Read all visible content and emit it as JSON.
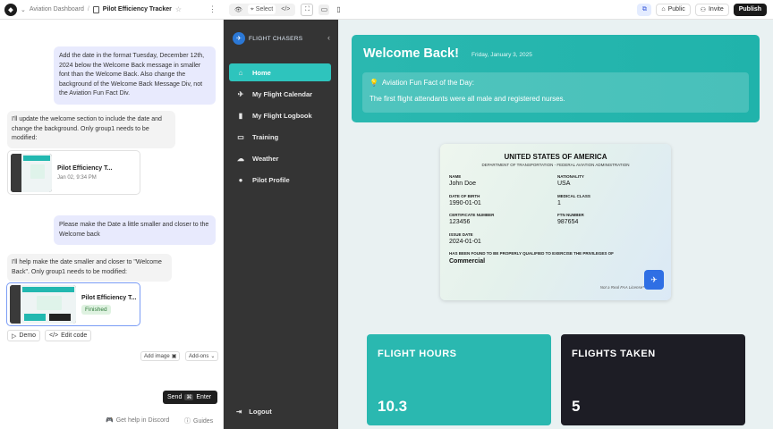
{
  "topbar": {
    "breadcrumb_root": "Aviation Dashboard",
    "project_title": "Pilot Efficiency Tracker",
    "select_label": "Select",
    "public_label": "Public",
    "invite_label": "Invite",
    "publish_label": "Publish"
  },
  "chat": {
    "msg1": "Add the date in the format Tuesday, December 12th, 2024 below the Welcome Back message in smaller font than the Welcome Back. Also change the background of the Welcome Back Message Div, not the Aviation Fun Fact Div.",
    "reply1": "I'll update the welcome section to include the date and change the background. Only group1 needs to be modified:",
    "card1": {
      "title": "Pilot Efficiency T...",
      "sub": "Jan 02, 9:34 PM"
    },
    "msg2": "Please make the Date a little smaller and closer to the Welcome back",
    "reply2": "I'll help make the date smaller and closer to \"Welcome Back\". Only group1 needs to be modified:",
    "card2": {
      "title": "Pilot Efficiency T...",
      "badge": "Finished"
    },
    "demo_label": "Demo",
    "edit_code_label": "Edit code",
    "add_image_label": "Add image",
    "addons_label": "Add-ons",
    "send_label": "Send",
    "send_key1": "⌘",
    "send_key2": "Enter",
    "discord_label": "Get help in Discord",
    "guides_label": "Guides"
  },
  "app": {
    "brand": "FLIGHT CHASERS",
    "nav": [
      {
        "label": "Home",
        "icon": "home-icon"
      },
      {
        "label": "My Flight Calendar",
        "icon": "plane-icon"
      },
      {
        "label": "My Flight Logbook",
        "icon": "book-icon"
      },
      {
        "label": "Training",
        "icon": "laptop-icon"
      },
      {
        "label": "Weather",
        "icon": "cloud-icon"
      },
      {
        "label": "Pilot Profile",
        "icon": "user-icon"
      }
    ],
    "logout_label": "Logout",
    "welcome_title": "Welcome Back!",
    "welcome_date": "Friday, January 3, 2025",
    "fact_heading": "Aviation Fun Fact of the Day:",
    "fact_text": "The first flight attendants were all male and registered nurses.",
    "license": {
      "country": "UNITED STATES OF AMERICA",
      "agency": "DEPARTMENT OF TRANSPORTATION - FEDERAL AVIATION ADMINISTRATION",
      "name_label": "NAME",
      "name": "John Doe",
      "nationality_label": "NATIONALITY",
      "nationality": "USA",
      "dob_label": "DATE OF BIRTH",
      "dob": "1990-01-01",
      "medical_label": "MEDICAL CLASS",
      "medical": "1",
      "cert_label": "CERTIFICATE NUMBER",
      "cert": "123456",
      "ftn_label": "FTN NUMBER",
      "ftn": "987654",
      "issue_label": "ISSUE DATE",
      "issue": "2024-01-01",
      "statement": "HAS BEEN FOUND TO BE PROPERLY QUALIFIED TO EXERCISE THE PRIVILEGES OF",
      "class": "Commercial",
      "note": "Not a Real FAA License*"
    },
    "stats": [
      {
        "label": "FLIGHT HOURS",
        "value": "10.3"
      },
      {
        "label": "FLIGHTS TAKEN",
        "value": "5"
      }
    ]
  },
  "colors": {
    "teal": "#2ab8b0",
    "sidebar": "#343434",
    "dark_card": "#1d1d25",
    "accent_blue": "#2f6fe4"
  }
}
